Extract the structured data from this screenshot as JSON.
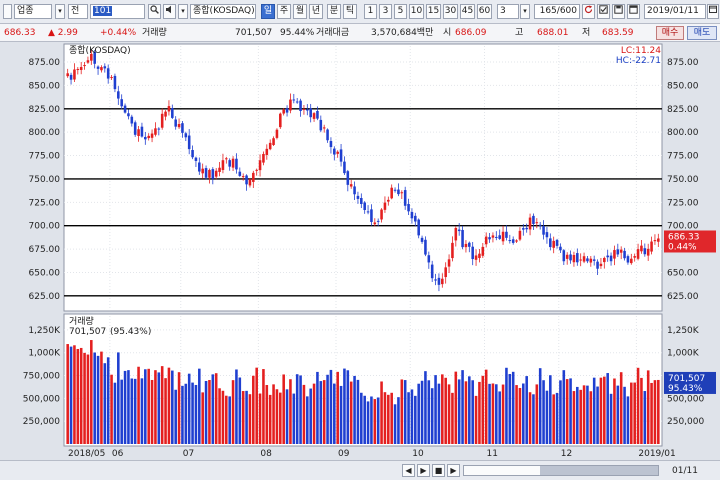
{
  "toolbar": {
    "market": "업종",
    "code_type": "전",
    "code": "101",
    "name": "종합(KOSDAQ)",
    "period_buttons": [
      "일",
      "주",
      "월",
      "년",
      "분",
      "틱"
    ],
    "minute_buttons": [
      "1",
      "3",
      "5",
      "10",
      "15",
      "30",
      "45",
      "60"
    ],
    "minute_select": "3",
    "count": "165/600",
    "date": "2019/01/11"
  },
  "info": {
    "price": "686.33",
    "change": "▲ 2.99",
    "rate": "+0.44%",
    "volume_label": "거래량",
    "volume": "701,507",
    "volume_ratio": "95.44%",
    "amount_label": "거래대금",
    "amount": "3,570,684백만",
    "open_label": "시",
    "open": "686.09",
    "high_label": "고",
    "high": "688.01",
    "low_label": "저",
    "low": "683.59",
    "buy": "매수",
    "sell": "매도"
  },
  "chart_data": [
    {
      "type": "candlestick",
      "title": "종합(KOSDAQ)",
      "y_ticks": [
        625,
        650,
        675,
        700,
        725,
        750,
        775,
        800,
        825,
        850,
        875
      ],
      "ylim": [
        612,
        890
      ],
      "hlines": [
        625,
        700,
        750,
        825
      ],
      "right_labels": {
        "lc": "LC:11.24",
        "hc": "HC:-22.71"
      },
      "last_price_label": "686.33",
      "last_rate_label": "0.44%",
      "last_value": 686.33,
      "grid": true,
      "x_labels": [
        "2018/05",
        "06",
        "07",
        "08",
        "09",
        "10",
        "11",
        "12",
        "2019/01"
      ],
      "x_label_index": [
        0,
        13,
        34,
        57,
        80,
        102,
        124,
        146,
        169
      ],
      "ohlc_anchor_closes": [
        858,
        866,
        874,
        882,
        873,
        862,
        851,
        822,
        813,
        798,
        787,
        801,
        812,
        824,
        808,
        791,
        779,
        758,
        751,
        759,
        769,
        770,
        761,
        748,
        756,
        768,
        790,
        811,
        822,
        832,
        828,
        822,
        817,
        802,
        785,
        768,
        748,
        732,
        718,
        706,
        710,
        728,
        738,
        731,
        716,
        694,
        668,
        641,
        644,
        668,
        692,
        682,
        670,
        676,
        686,
        694,
        691,
        682,
        693,
        702,
        709,
        698,
        683,
        673,
        668,
        661,
        666,
        660,
        657,
        664,
        668,
        672,
        662,
        666,
        673,
        680,
        686
      ]
    },
    {
      "type": "bar",
      "title": "거래량",
      "label": "701,507",
      "ratio": "(95.43%)",
      "y_ticks": [
        250000,
        500000,
        750000,
        1000000,
        1250000
      ],
      "y_tick_labels": [
        "250,000",
        "500,000",
        "750,000",
        "1,000K",
        "1,250K"
      ],
      "ylim": [
        0,
        1380000
      ],
      "last_value": 701507,
      "last_label": "701,507",
      "last_ratio": "95.43%"
    }
  ],
  "bottom": {
    "zoom_buttons": [
      "◀",
      "▶",
      "■",
      "▶"
    ],
    "end_label": "01/11"
  }
}
